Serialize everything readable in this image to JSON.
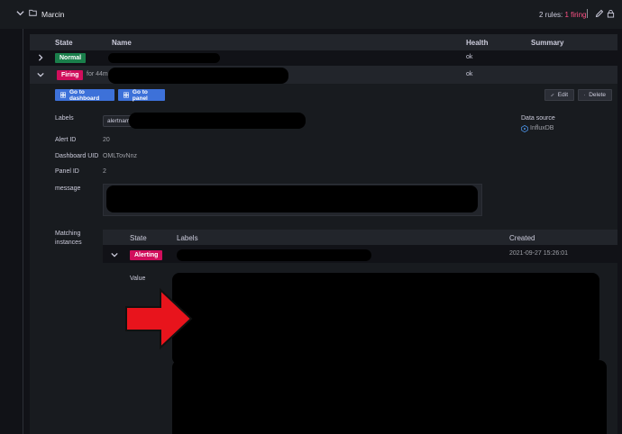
{
  "folder": {
    "name": "Marcin",
    "rules_prefix": "2 rules: ",
    "rules_firing": "1 firing"
  },
  "rules_table": {
    "headers": {
      "state": "State",
      "name": "Name",
      "health": "Health",
      "summary": "Summary"
    },
    "rows": [
      {
        "state": "Normal",
        "health": "ok"
      },
      {
        "state": "Firing",
        "duration": "for 44m",
        "health": "ok"
      }
    ]
  },
  "actions": {
    "go_dashboard": "Go to dashboard",
    "go_panel": "Go to panel",
    "edit": "Edit",
    "delete": "Delete"
  },
  "details": {
    "labels_label": "Labels",
    "labels_chip": "alertname",
    "alert_id_label": "Alert ID",
    "alert_id": "20",
    "dashboard_uid_label": "Dashboard UID",
    "dashboard_uid": "OMLTovNnz",
    "panel_id_label": "Panel ID",
    "panel_id": "2",
    "message_label": "message",
    "data_source_label": "Data source",
    "data_source": "InfluxDB",
    "matching_label_1": "Matching",
    "matching_label_2": "instances"
  },
  "instances": {
    "headers": {
      "state": "State",
      "labels": "Labels",
      "created": "Created"
    },
    "row": {
      "state": "Alerting",
      "created": "2021-09-27 15:26:01"
    },
    "value_label": "Value"
  },
  "colors": {
    "firing": "#d10e5c",
    "normal": "#1a7f4b",
    "primary": "#3d71d9",
    "arrow": "#e8141c"
  }
}
